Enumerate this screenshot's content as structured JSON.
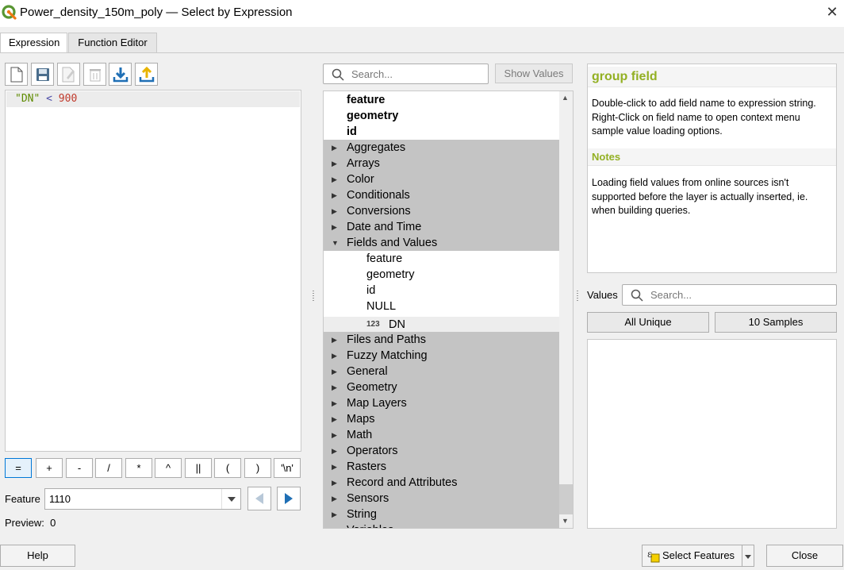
{
  "window": {
    "title": "Power_density_150m_poly — Select by Expression",
    "close_icon": "close-icon"
  },
  "tabs": [
    {
      "label": "Expression",
      "active": true
    },
    {
      "label": "Function Editor",
      "active": false
    }
  ],
  "toolbar": {
    "icons": [
      "new-file-icon",
      "save-icon",
      "edit-icon",
      "delete-icon",
      "import-icon",
      "export-icon"
    ]
  },
  "editor": {
    "field": "\"DN\"",
    "operator": "<",
    "number": "900"
  },
  "operators": [
    "=",
    "+",
    "-",
    "/",
    "*",
    "^",
    "||",
    "(",
    ")",
    "'\\n'"
  ],
  "feature": {
    "label": "Feature",
    "value": "1110"
  },
  "preview": {
    "text": "Preview:  0"
  },
  "function_search": {
    "placeholder": "Search...",
    "show_values_label": "Show Values"
  },
  "tree": {
    "rows": [
      {
        "label": "feature",
        "kind": "bold"
      },
      {
        "label": "geometry",
        "kind": "bold"
      },
      {
        "label": "id",
        "kind": "bold"
      },
      {
        "label": "Aggregates",
        "kind": "group",
        "expanded": false
      },
      {
        "label": "Arrays",
        "kind": "group",
        "expanded": false
      },
      {
        "label": "Color",
        "kind": "group",
        "expanded": false
      },
      {
        "label": "Conditionals",
        "kind": "group",
        "expanded": false
      },
      {
        "label": "Conversions",
        "kind": "group",
        "expanded": false
      },
      {
        "label": "Date and Time",
        "kind": "group",
        "expanded": false
      },
      {
        "label": "Fields and Values",
        "kind": "group",
        "expanded": true
      },
      {
        "label": "feature",
        "kind": "child"
      },
      {
        "label": "geometry",
        "kind": "child"
      },
      {
        "label": "id",
        "kind": "child"
      },
      {
        "label": "NULL",
        "kind": "child"
      },
      {
        "label": "DN",
        "kind": "field",
        "badge": "123"
      },
      {
        "label": "Files and Paths",
        "kind": "group",
        "expanded": false
      },
      {
        "label": "Fuzzy Matching",
        "kind": "group",
        "expanded": false
      },
      {
        "label": "General",
        "kind": "group",
        "expanded": false
      },
      {
        "label": "Geometry",
        "kind": "group",
        "expanded": false
      },
      {
        "label": "Map Layers",
        "kind": "group",
        "expanded": false
      },
      {
        "label": "Maps",
        "kind": "group",
        "expanded": false
      },
      {
        "label": "Math",
        "kind": "group",
        "expanded": false
      },
      {
        "label": "Operators",
        "kind": "group",
        "expanded": false
      },
      {
        "label": "Rasters",
        "kind": "group",
        "expanded": false
      },
      {
        "label": "Record and Attributes",
        "kind": "group",
        "expanded": false
      },
      {
        "label": "Sensors",
        "kind": "group",
        "expanded": false
      },
      {
        "label": "String",
        "kind": "group",
        "expanded": false
      },
      {
        "label": "Variables",
        "kind": "group",
        "expanded": false
      }
    ]
  },
  "help": {
    "title": "group field",
    "description_1": "Double-click to add field name to expression string.",
    "description_2": "Right-Click on field name to open context menu sample value loading options.",
    "notes_title": "Notes",
    "notes": "Loading field values from online sources isn't supported before the layer is actually inserted, ie. when building queries."
  },
  "values": {
    "label": "Values",
    "placeholder": "Search...",
    "all_unique_label": "All Unique",
    "samples_label": "10 Samples"
  },
  "buttons": {
    "help_label": "Help",
    "select_features_label": "Select Features",
    "close_label": "Close"
  },
  "colors": {
    "accent_green": "#93b023",
    "group_bg": "#c4c4c4",
    "nav_blue": "#1f6fb5"
  }
}
